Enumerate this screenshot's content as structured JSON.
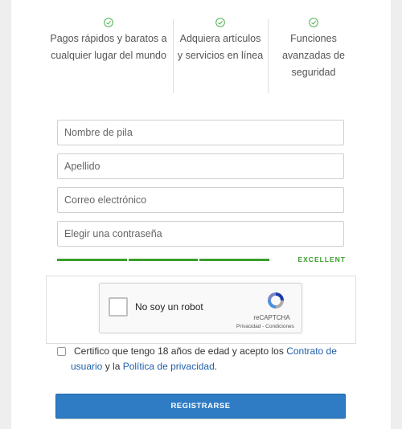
{
  "features": [
    {
      "line1": "Pagos rápidos y baratos a",
      "line2": "cualquier lugar del mundo",
      "line3": ""
    },
    {
      "line1": "Adquiera artículos",
      "line2": "y servicios en línea",
      "line3": ""
    },
    {
      "line1": "Funciones",
      "line2": "avanzadas de",
      "line3": "seguridad"
    }
  ],
  "form": {
    "first_name": {
      "placeholder": "Nombre de pila",
      "value": ""
    },
    "last_name": {
      "placeholder": "Apellido",
      "value": ""
    },
    "email": {
      "placeholder": "Correo electrónico",
      "value": ""
    },
    "password": {
      "placeholder": "Elegir una contraseña",
      "value": ""
    }
  },
  "strength": {
    "label": "EXCELLENT",
    "level": 1.0,
    "segments_filled": 3,
    "color": "#3a9e2c"
  },
  "captcha": {
    "label": "No soy un robot",
    "brand": "reCAPTCHA",
    "terms": "Privacidad - Condiciones"
  },
  "terms": {
    "text_before": "Certifico que tengo 18 años de edad y acepto los ",
    "link1_part1": "Contrato de",
    "link1_part2": "usuario",
    "text_middle": " y la ",
    "link2": "Política de privacidad",
    "text_end": "."
  },
  "register_button": {
    "label": "REGISTRARSE"
  },
  "colors": {
    "accent": "#2f7cc4",
    "link": "#1f5fa8",
    "success": "#3a9e2c"
  }
}
